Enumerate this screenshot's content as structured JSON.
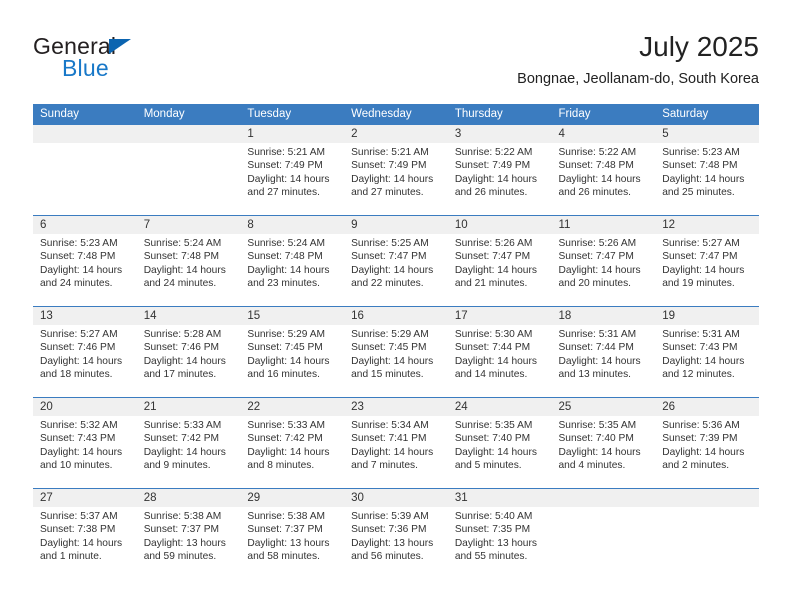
{
  "brand": {
    "name_part1": "General",
    "name_part2": "Blue",
    "triangle_icon": "blue-triangle-logo-mark",
    "accent_color": "#1878c8",
    "dark_color": "#231f20"
  },
  "header": {
    "title": "July 2025",
    "subtitle": "Bongnae, Jeollanam-do, South Korea"
  },
  "theme": {
    "header_blue": "#3b7cc0",
    "daynum_strip_gray": "#f0f0f0",
    "text_color": "#333333"
  },
  "calendar": {
    "weekday_headers": [
      "Sunday",
      "Monday",
      "Tuesday",
      "Wednesday",
      "Thursday",
      "Friday",
      "Saturday"
    ],
    "weeks": [
      [
        {
          "day": "",
          "lines": []
        },
        {
          "day": "",
          "lines": []
        },
        {
          "day": "1",
          "lines": [
            "Sunrise: 5:21 AM",
            "Sunset: 7:49 PM",
            "Daylight: 14 hours",
            "and 27 minutes."
          ]
        },
        {
          "day": "2",
          "lines": [
            "Sunrise: 5:21 AM",
            "Sunset: 7:49 PM",
            "Daylight: 14 hours",
            "and 27 minutes."
          ]
        },
        {
          "day": "3",
          "lines": [
            "Sunrise: 5:22 AM",
            "Sunset: 7:49 PM",
            "Daylight: 14 hours",
            "and 26 minutes."
          ]
        },
        {
          "day": "4",
          "lines": [
            "Sunrise: 5:22 AM",
            "Sunset: 7:48 PM",
            "Daylight: 14 hours",
            "and 26 minutes."
          ]
        },
        {
          "day": "5",
          "lines": [
            "Sunrise: 5:23 AM",
            "Sunset: 7:48 PM",
            "Daylight: 14 hours",
            "and 25 minutes."
          ]
        }
      ],
      [
        {
          "day": "6",
          "lines": [
            "Sunrise: 5:23 AM",
            "Sunset: 7:48 PM",
            "Daylight: 14 hours",
            "and 24 minutes."
          ]
        },
        {
          "day": "7",
          "lines": [
            "Sunrise: 5:24 AM",
            "Sunset: 7:48 PM",
            "Daylight: 14 hours",
            "and 24 minutes."
          ]
        },
        {
          "day": "8",
          "lines": [
            "Sunrise: 5:24 AM",
            "Sunset: 7:48 PM",
            "Daylight: 14 hours",
            "and 23 minutes."
          ]
        },
        {
          "day": "9",
          "lines": [
            "Sunrise: 5:25 AM",
            "Sunset: 7:47 PM",
            "Daylight: 14 hours",
            "and 22 minutes."
          ]
        },
        {
          "day": "10",
          "lines": [
            "Sunrise: 5:26 AM",
            "Sunset: 7:47 PM",
            "Daylight: 14 hours",
            "and 21 minutes."
          ]
        },
        {
          "day": "11",
          "lines": [
            "Sunrise: 5:26 AM",
            "Sunset: 7:47 PM",
            "Daylight: 14 hours",
            "and 20 minutes."
          ]
        },
        {
          "day": "12",
          "lines": [
            "Sunrise: 5:27 AM",
            "Sunset: 7:47 PM",
            "Daylight: 14 hours",
            "and 19 minutes."
          ]
        }
      ],
      [
        {
          "day": "13",
          "lines": [
            "Sunrise: 5:27 AM",
            "Sunset: 7:46 PM",
            "Daylight: 14 hours",
            "and 18 minutes."
          ]
        },
        {
          "day": "14",
          "lines": [
            "Sunrise: 5:28 AM",
            "Sunset: 7:46 PM",
            "Daylight: 14 hours",
            "and 17 minutes."
          ]
        },
        {
          "day": "15",
          "lines": [
            "Sunrise: 5:29 AM",
            "Sunset: 7:45 PM",
            "Daylight: 14 hours",
            "and 16 minutes."
          ]
        },
        {
          "day": "16",
          "lines": [
            "Sunrise: 5:29 AM",
            "Sunset: 7:45 PM",
            "Daylight: 14 hours",
            "and 15 minutes."
          ]
        },
        {
          "day": "17",
          "lines": [
            "Sunrise: 5:30 AM",
            "Sunset: 7:44 PM",
            "Daylight: 14 hours",
            "and 14 minutes."
          ]
        },
        {
          "day": "18",
          "lines": [
            "Sunrise: 5:31 AM",
            "Sunset: 7:44 PM",
            "Daylight: 14 hours",
            "and 13 minutes."
          ]
        },
        {
          "day": "19",
          "lines": [
            "Sunrise: 5:31 AM",
            "Sunset: 7:43 PM",
            "Daylight: 14 hours",
            "and 12 minutes."
          ]
        }
      ],
      [
        {
          "day": "20",
          "lines": [
            "Sunrise: 5:32 AM",
            "Sunset: 7:43 PM",
            "Daylight: 14 hours",
            "and 10 minutes."
          ]
        },
        {
          "day": "21",
          "lines": [
            "Sunrise: 5:33 AM",
            "Sunset: 7:42 PM",
            "Daylight: 14 hours",
            "and 9 minutes."
          ]
        },
        {
          "day": "22",
          "lines": [
            "Sunrise: 5:33 AM",
            "Sunset: 7:42 PM",
            "Daylight: 14 hours",
            "and 8 minutes."
          ]
        },
        {
          "day": "23",
          "lines": [
            "Sunrise: 5:34 AM",
            "Sunset: 7:41 PM",
            "Daylight: 14 hours",
            "and 7 minutes."
          ]
        },
        {
          "day": "24",
          "lines": [
            "Sunrise: 5:35 AM",
            "Sunset: 7:40 PM",
            "Daylight: 14 hours",
            "and 5 minutes."
          ]
        },
        {
          "day": "25",
          "lines": [
            "Sunrise: 5:35 AM",
            "Sunset: 7:40 PM",
            "Daylight: 14 hours",
            "and 4 minutes."
          ]
        },
        {
          "day": "26",
          "lines": [
            "Sunrise: 5:36 AM",
            "Sunset: 7:39 PM",
            "Daylight: 14 hours",
            "and 2 minutes."
          ]
        }
      ],
      [
        {
          "day": "27",
          "lines": [
            "Sunrise: 5:37 AM",
            "Sunset: 7:38 PM",
            "Daylight: 14 hours",
            "and 1 minute."
          ]
        },
        {
          "day": "28",
          "lines": [
            "Sunrise: 5:38 AM",
            "Sunset: 7:37 PM",
            "Daylight: 13 hours",
            "and 59 minutes."
          ]
        },
        {
          "day": "29",
          "lines": [
            "Sunrise: 5:38 AM",
            "Sunset: 7:37 PM",
            "Daylight: 13 hours",
            "and 58 minutes."
          ]
        },
        {
          "day": "30",
          "lines": [
            "Sunrise: 5:39 AM",
            "Sunset: 7:36 PM",
            "Daylight: 13 hours",
            "and 56 minutes."
          ]
        },
        {
          "day": "31",
          "lines": [
            "Sunrise: 5:40 AM",
            "Sunset: 7:35 PM",
            "Daylight: 13 hours",
            "and 55 minutes."
          ]
        },
        {
          "day": "",
          "lines": []
        },
        {
          "day": "",
          "lines": []
        }
      ]
    ]
  }
}
